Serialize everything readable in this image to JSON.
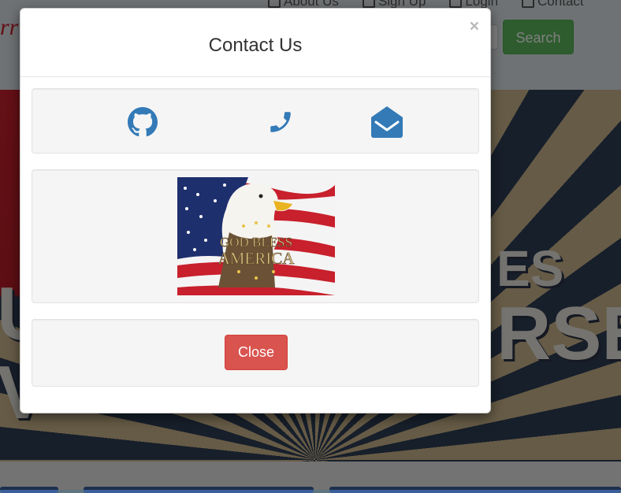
{
  "background": {
    "brand": "rr",
    "nav_links": [
      "About Us",
      "Sign Up",
      "Login",
      "Contact"
    ],
    "search_button": "Search",
    "hero_words": [
      "ES",
      "RSE",
      "U",
      "V"
    ]
  },
  "modal": {
    "title": "Contact Us",
    "close_x": "×",
    "icons": [
      "github-icon",
      "phone-icon",
      "envelope-open-icon"
    ],
    "image_text": [
      "GOD BLESS",
      "AMERICA"
    ],
    "close_button": "Close"
  },
  "colors": {
    "icon_blue": "#337ab7",
    "danger": "#d9534f",
    "success": "#5cb85c"
  }
}
